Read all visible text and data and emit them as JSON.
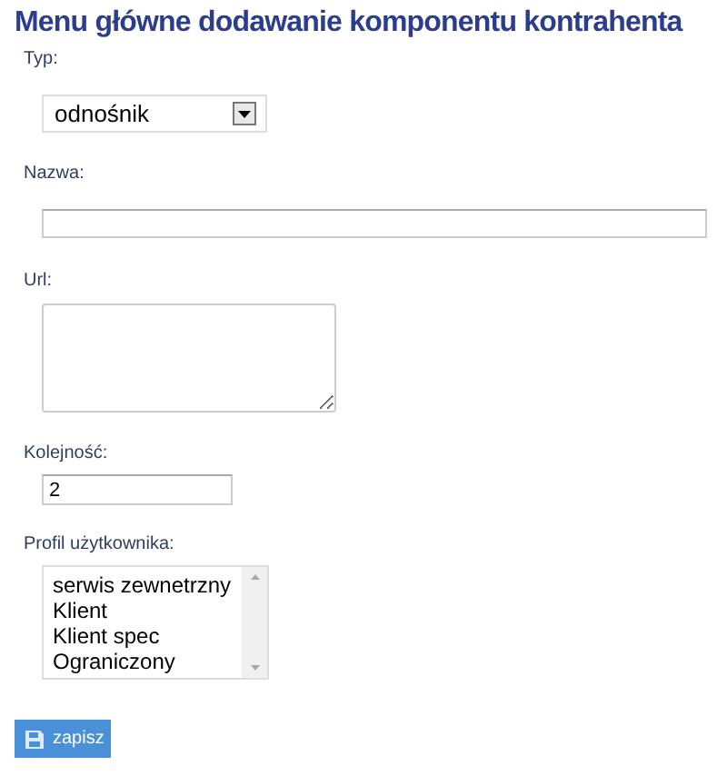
{
  "title": "Menu główne dodawanie komponentu kontrahenta",
  "fields": [
    {
      "kind": "select",
      "label": "Typ:",
      "value": "odnośnik"
    },
    {
      "kind": "text",
      "label": "Nazwa:"
    },
    {
      "kind": "textarea",
      "label": "Url:"
    },
    {
      "kind": "number",
      "label": "Kolejność:",
      "value": "2"
    },
    {
      "kind": "listbox",
      "label": "Profil użytkownika:",
      "options": [
        "serwis zewnetrzny",
        "Klient",
        "Klient spec",
        "Ograniczony"
      ]
    }
  ],
  "save_button": {
    "label": "zapisz"
  }
}
